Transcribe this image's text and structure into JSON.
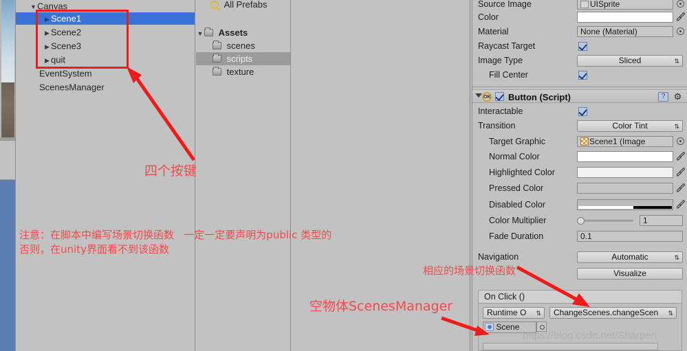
{
  "hierarchy": {
    "rows": [
      {
        "label": "Canvas",
        "indent": 20,
        "tri": "▼",
        "selected": false
      },
      {
        "label": "Scene1",
        "indent": 40,
        "tri": "▶",
        "selected": true
      },
      {
        "label": "Scene2",
        "indent": 40,
        "tri": "▶",
        "selected": false
      },
      {
        "label": "Scene3",
        "indent": 40,
        "tri": "▶",
        "selected": false
      },
      {
        "label": "quit",
        "indent": 40,
        "tri": "▶",
        "selected": false
      },
      {
        "label": "EventSystem",
        "indent": 34,
        "tri": "",
        "selected": false
      },
      {
        "label": "ScenesManager",
        "indent": 34,
        "tri": "",
        "selected": false
      }
    ]
  },
  "project": {
    "all_prefabs": "All Prefabs",
    "all_prefabs_icon": "search-icon",
    "rows": [
      {
        "label": "Assets",
        "indent": 8,
        "tri": "▼",
        "bold": true,
        "selected": false
      },
      {
        "label": "scenes",
        "indent": 22,
        "tri": "",
        "bold": false,
        "selected": false
      },
      {
        "label": "scripts",
        "indent": 22,
        "tri": "",
        "bold": false,
        "selected": true
      },
      {
        "label": "texture",
        "indent": 22,
        "tri": "",
        "bold": false,
        "selected": false
      }
    ]
  },
  "inspector": {
    "image_component": {
      "rows": [
        {
          "label": "Source Image",
          "type": "object",
          "value": "UISprite",
          "icon": "sprite-icon"
        },
        {
          "label": "Color",
          "type": "color",
          "value": "",
          "swatch": "#ffffff"
        },
        {
          "label": "Material",
          "type": "object",
          "value": "None (Material)",
          "icon": ""
        },
        {
          "label": "Raycast Target",
          "type": "checkbox",
          "value": "checked"
        },
        {
          "label": "Image Type",
          "type": "popup",
          "value": "Sliced"
        },
        {
          "label": "Fill Center",
          "type": "checkbox",
          "value": "checked",
          "indent": true
        }
      ]
    },
    "button_component": {
      "title": "Button (Script)",
      "enabled": true,
      "badge": "OK",
      "help_icon": "help-icon",
      "gear_icon": "gear-icon",
      "rows": [
        {
          "label": "Interactable",
          "type": "checkbox",
          "value": "checked"
        },
        {
          "label": "Transition",
          "type": "popup",
          "value": "Color Tint"
        },
        {
          "label": "Target Graphic",
          "type": "object",
          "value": "Scene1 (Image",
          "indent": true,
          "icon": "sprite-checker-icon"
        },
        {
          "label": "Normal Color",
          "type": "color",
          "value": "",
          "indent": true,
          "swatch": "#ffffff"
        },
        {
          "label": "Highlighted Color",
          "type": "color",
          "value": "",
          "indent": true,
          "swatch": "#f4f4f4"
        },
        {
          "label": "Pressed Color",
          "type": "color",
          "value": "",
          "indent": true,
          "swatch": "#c8c8c8"
        },
        {
          "label": "Disabled Color",
          "type": "color",
          "value": "",
          "indent": true,
          "swatch": "#b9b9b9"
        },
        {
          "label": "Color Multiplier",
          "type": "slider",
          "value": "1",
          "indent": true
        },
        {
          "label": "Fade Duration",
          "type": "text",
          "value": "0.1",
          "indent": true
        }
      ],
      "navigation": {
        "label": "Navigation",
        "value": "Automatic"
      },
      "visualize_button": "Visualize",
      "on_click": {
        "header": "On Click ()",
        "entry": {
          "runtime": "Runtime O",
          "function": "ChangeScenes.changeScen",
          "object": "Scene"
        }
      }
    }
  },
  "annotations": {
    "four_buttons": "四个按键",
    "note_line1": "注意：在脚本中编写场景切换函数   一定一定要声明为public 类型的",
    "note_line2": "否则，在unity界面看不到该函数",
    "scene_switch_func": "相应的场景切换函数",
    "empty_object": "空物体ScenesManager"
  },
  "watermark": "https://blog.csdn.net/Sharpen",
  "colors": {
    "panel_bg": "#c2c2c2",
    "selection_blue": "#3a72d8",
    "selection_gray": "#9b9b9b",
    "annotation_red": "#f14a4a",
    "box_red": "#ef1b1b"
  }
}
